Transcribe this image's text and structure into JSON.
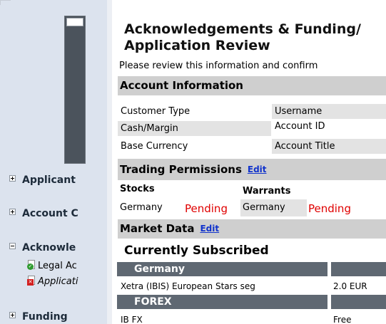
{
  "progress_fraction": 0.06,
  "sidebar": {
    "items": [
      {
        "label": "Applicant"
      },
      {
        "label": "Account C"
      },
      {
        "label": "Acknowle"
      },
      {
        "label": "Funding"
      }
    ],
    "sub_items": [
      {
        "label": "Legal Ac",
        "status": "complete"
      },
      {
        "label": "Applicati",
        "status": "incomplete"
      }
    ]
  },
  "main": {
    "title_line1": "Acknowledgements & Funding/",
    "title_line2": "Application Review",
    "intro": "Please review this information and confirm",
    "account_info": {
      "header": "Account Information",
      "rows": [
        {
          "left": "Customer Type",
          "right": "Username"
        },
        {
          "left": "Cash/Margin",
          "right": "Account ID"
        },
        {
          "left": "Base Currency",
          "right": "Account Title"
        }
      ]
    },
    "trading_permissions": {
      "header": "Trading Permissions",
      "edit": "Edit",
      "col1": "Stocks",
      "col2": "Warrants",
      "row": {
        "c1": "Germany",
        "c2": "Pending",
        "c3": "Germany",
        "c4": "Pending"
      }
    },
    "market_data": {
      "header": "Market Data",
      "edit": "Edit",
      "subtitle": "Currently Subscribed",
      "groups": [
        {
          "name": "Germany",
          "service": "Xetra (IBIS) European Stars seg",
          "price": "2.0 EUR"
        },
        {
          "name": "FOREX",
          "service": "IB FX",
          "price": "Free"
        }
      ]
    }
  },
  "colors": {
    "sidebar_bg": "#dce3ee",
    "section_header_bg": "#cfcfcf",
    "region_bar_bg": "#5f6872",
    "link": "#1133cc",
    "pending": "#e00000"
  }
}
